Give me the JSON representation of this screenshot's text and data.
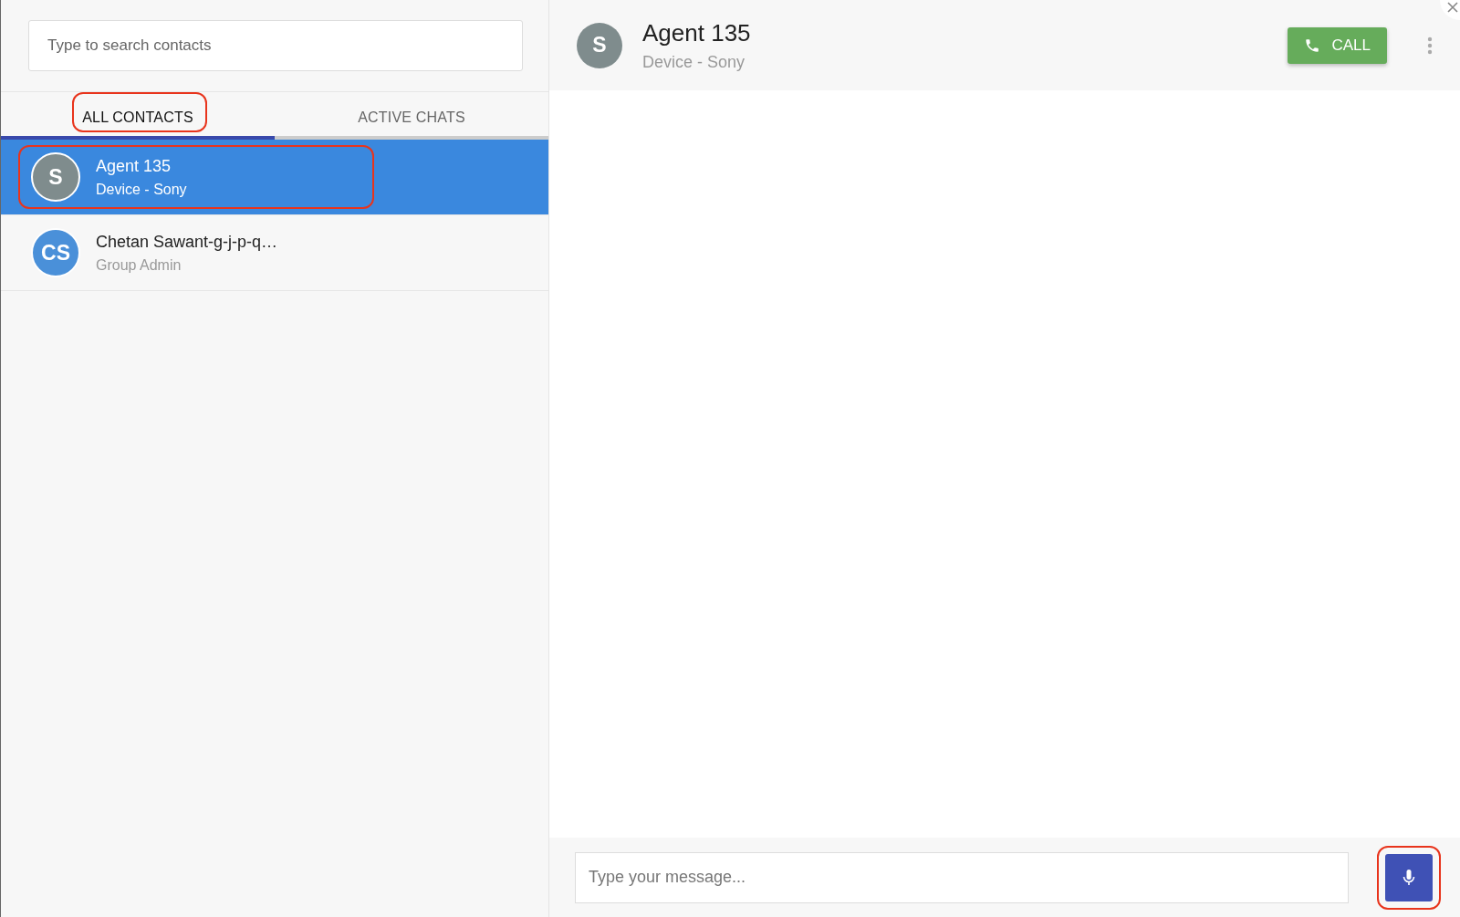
{
  "search": {
    "placeholder": "Type to search contacts"
  },
  "tabs": [
    {
      "label": "ALL CONTACTS",
      "selected": true,
      "highlighted": true
    },
    {
      "label": "ACTIVE CHATS",
      "selected": false,
      "highlighted": false
    }
  ],
  "contacts": [
    {
      "initials": "S",
      "name": "Agent 135",
      "subtitle": "Device - Sony",
      "selected": true,
      "highlighted": true,
      "color": "#7f8c8d"
    },
    {
      "initials": "CS",
      "name": "Chetan Sawant-g-j-p-q…",
      "subtitle": "Group Admin",
      "selected": false,
      "highlighted": false,
      "color": "#4a90d9"
    }
  ],
  "chat_header": {
    "initials": "S",
    "name": "Agent 135",
    "subtitle": "Device - Sony",
    "call_label": "CALL"
  },
  "composer": {
    "placeholder": "Type your message...",
    "mic_highlighted": true
  }
}
